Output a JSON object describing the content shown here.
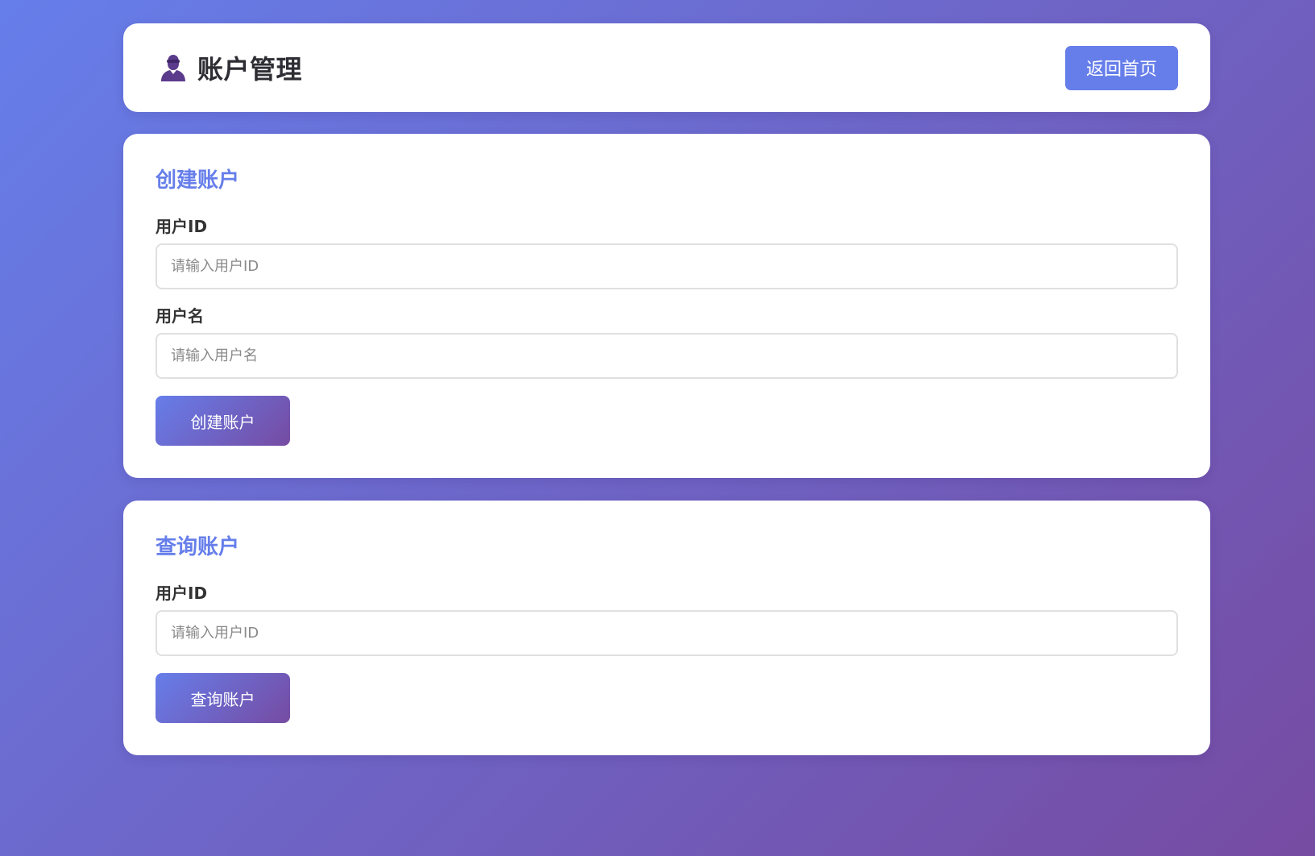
{
  "header": {
    "title": "账户管理",
    "home_button": "返回首页"
  },
  "create_account": {
    "title": "创建账户",
    "user_id": {
      "label": "用户ID",
      "placeholder": "请输入用户ID",
      "value": ""
    },
    "username": {
      "label": "用户名",
      "placeholder": "请输入用户名",
      "value": ""
    },
    "submit_label": "创建账户"
  },
  "query_account": {
    "title": "查询账户",
    "user_id": {
      "label": "用户ID",
      "placeholder": "请输入用户ID",
      "value": ""
    },
    "submit_label": "查询账户"
  },
  "colors": {
    "accent": "#667eea",
    "gradient_start": "#667eea",
    "gradient_end": "#764ba2",
    "icon": "#5a3b8c"
  },
  "icons": {
    "title_icon": "user-icon"
  }
}
